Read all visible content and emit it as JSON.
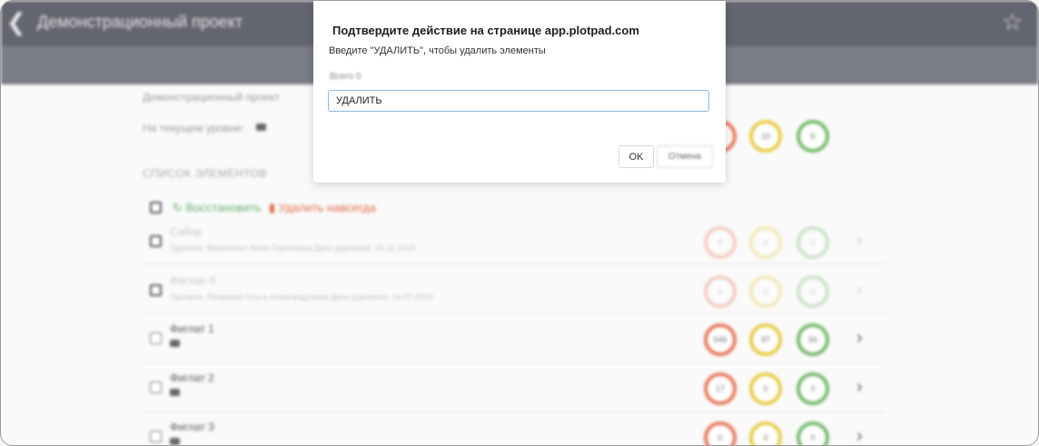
{
  "header": {
    "back_icon": "chevron-left-icon",
    "title": "Демонстрационный проект",
    "star_icon": "star-icon"
  },
  "info": {
    "breadcrumb": "Демонстрационный проект",
    "level_label": "На текущем уровне:",
    "level_counts": [
      "",
      "10",
      "5"
    ]
  },
  "list": {
    "section_title": "СПИСОК ЭЛЕМЕНТОВ",
    "restore_label": "Восстановить",
    "delete_label": "Удалить навсегда",
    "rows": [
      {
        "name": "Сабор",
        "meta": "Удалила: Василенко Алия Сергеевна Дата удаления: 20.11.2019",
        "counts": [
          "0",
          "0",
          "0"
        ],
        "deleted": true,
        "checked": false
      },
      {
        "name": "Фиглан 0",
        "meta": "Удалила: Рязанова Ольга Александровна Дата удаления: 16.07.2019",
        "counts": [
          "0",
          "0",
          "0"
        ],
        "deleted": true,
        "checked": true
      },
      {
        "name": "Фиглат 1",
        "meta": "",
        "counts": [
          "546",
          "97",
          "56"
        ],
        "deleted": false,
        "checked": false
      },
      {
        "name": "Фиглат 2",
        "meta": "",
        "counts": [
          "17",
          "0",
          "0"
        ],
        "deleted": false,
        "checked": false
      },
      {
        "name": "Фиглат 3",
        "meta": "",
        "counts": [
          "0",
          "0",
          "0"
        ],
        "deleted": false,
        "checked": false
      }
    ]
  },
  "dialog": {
    "title": "Подтвердите действие на странице app.plotpad.com",
    "message": "Введите \"УДАЛИТЬ\", чтобы удалить элементы",
    "field_label": "Всего 0",
    "input_value": "УДАЛИТЬ",
    "ok_label": "OK",
    "cancel_label": "Отмена"
  },
  "colors": {
    "red": "#e8785a",
    "yellow": "#e9cb45",
    "green": "#74b96a",
    "header": "#636570"
  }
}
